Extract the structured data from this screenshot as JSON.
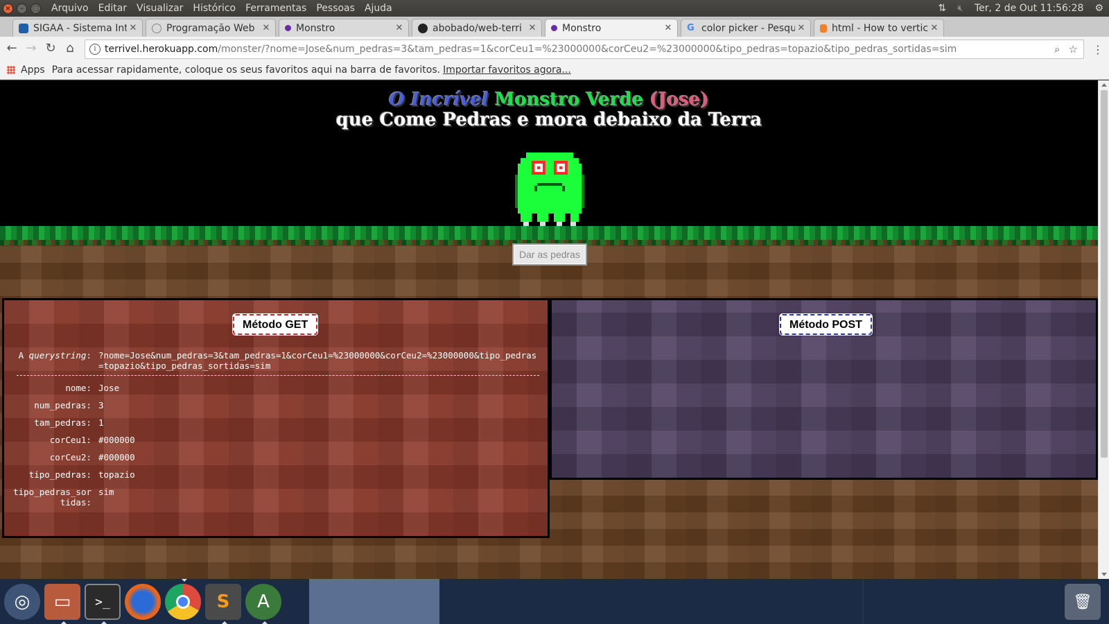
{
  "topbar": {
    "menu": [
      "Arquivo",
      "Editar",
      "Visualizar",
      "Histórico",
      "Ferramentas",
      "Pessoas",
      "Ajuda"
    ],
    "datetime": "Ter,  2 de Out 11:56:28"
  },
  "tabs": [
    {
      "label": "SIGAA - Sistema Inte",
      "icon": "sigaa-icon",
      "color": "#1f5fa8"
    },
    {
      "label": "Programação Web",
      "icon": "globe-icon",
      "color": "#888888"
    },
    {
      "label": "Monstro",
      "icon": "monster-favicon",
      "color": "#6a2aa8"
    },
    {
      "label": "abobado/web-terri",
      "icon": "github-icon",
      "color": "#222222"
    },
    {
      "label": "Monstro",
      "icon": "monster-favicon",
      "color": "#6a2aa8",
      "active": true
    },
    {
      "label": "color picker - Pesqu",
      "icon": "google-icon",
      "color": "#4285f4"
    },
    {
      "label": "html - How to vertic",
      "icon": "stackoverflow-icon",
      "color": "#f48024"
    }
  ],
  "address": {
    "host": "terrivel.herokuapp.com",
    "path": "/monster/?nome=Jose&num_pedras=3&tam_pedras=1&corCeu1=%23000000&corCeu2=%23000000&tipo_pedras=topazio&tipo_pedras_sortidas=sim"
  },
  "bookmarks": {
    "apps": "Apps",
    "hint": "Para acessar rapidamente, coloque os seus favoritos aqui na barra de favoritos.",
    "import_link": "Importar favoritos agora..."
  },
  "page": {
    "title_pre": "O Incrível",
    "title_monster": "Monstro Verde",
    "title_name": "(Jose)",
    "title_line2": "que Come Pedras e mora debaixo da Terra",
    "button": "Dar as pedras",
    "get_title": "Método GET",
    "post_title": "Método POST",
    "querystring_label": "querystring",
    "querystring_prefix": "A ",
    "querystring_value": "?nome=Jose&num_pedras=3&tam_pedras=1&corCeu1=%23000000&corCeu2=%23000000&tipo_pedras=topazio&tipo_pedras_sortidas=sim",
    "params": [
      {
        "key": "nome:",
        "value": "Jose"
      },
      {
        "key": "num_pedras:",
        "value": "3"
      },
      {
        "key": "tam_pedras:",
        "value": "1"
      },
      {
        "key": "corCeu1:",
        "value": "#000000"
      },
      {
        "key": "corCeu2:",
        "value": "#000000"
      },
      {
        "key": "tipo_pedras:",
        "value": "topazio"
      },
      {
        "key": "tipo_pedras_sortidas:",
        "value": "sim"
      }
    ]
  },
  "colors": {
    "monster": "#1aff3a",
    "grass": "#14882f",
    "dirt": "#6b4425",
    "get_panel": "#8c3a2c",
    "post_panel": "#4e4060"
  },
  "dock": [
    "ubuntu-dash-icon",
    "files-icon",
    "terminal-icon",
    "firefox-icon",
    "chrome-icon",
    "sublime-icon",
    "software-updater-icon",
    "trash-icon"
  ]
}
